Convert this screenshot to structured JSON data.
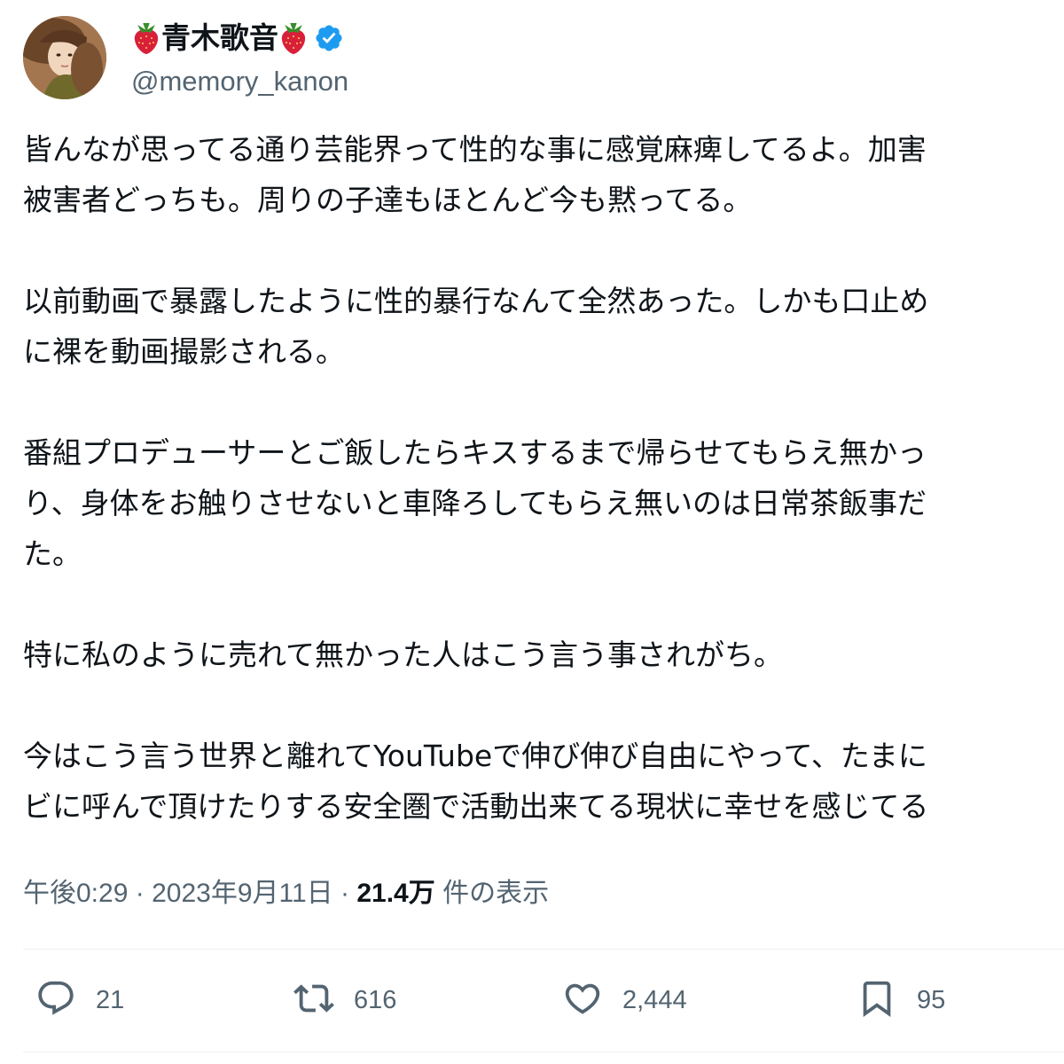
{
  "author": {
    "display_name": "青木歌音",
    "name_emoji": "strawberry-icon",
    "verified_icon": "verified-badge-icon",
    "handle": "@memory_kanon"
  },
  "tweet": {
    "paragraphs": [
      {
        "lines": [
          "皆んなが思ってる通り芸能界って性的な事に感覚麻痺してるよ。加害",
          "被害者どっちも。周りの子達もほとんど今も黙ってる。"
        ]
      },
      {
        "lines": [
          "以前動画で暴露したように性的暴行なんて全然あった。しかも口止め",
          "に裸を動画撮影される。"
        ]
      },
      {
        "lines": [
          "番組プロデューサーとご飯したらキスするまで帰らせてもらえ無かっ",
          "り、身体をお触りさせないと車降ろしてもらえ無いのは日常茶飯事だ",
          "た。"
        ]
      },
      {
        "lines": [
          "特に私のように売れて無かった人はこう言う事されがち。"
        ]
      },
      {
        "lines": [
          "今はこう言う世界と離れてYouTubeで伸び伸び自由にやって、たまに",
          "ビに呼んで頂けたりする安全圏で活動出来てる現状に幸せを感じてる"
        ]
      }
    ]
  },
  "meta": {
    "time": "午後0:29",
    "separator": "·",
    "date": "2023年9月11日",
    "views_count": "21.4万",
    "views_label": "件の表示"
  },
  "actions": {
    "reply": {
      "icon": "reply-icon",
      "count": "21"
    },
    "retweet": {
      "icon": "retweet-icon",
      "count": "616"
    },
    "like": {
      "icon": "heart-icon",
      "count": "2,444"
    },
    "bookmark": {
      "icon": "bookmark-icon",
      "count": "95"
    }
  },
  "colors": {
    "text_primary": "#0f1419",
    "text_secondary": "#536471",
    "verified_blue": "#1d9bf0",
    "strawberry_red": "#d8203a",
    "divider": "#eff3f4"
  }
}
